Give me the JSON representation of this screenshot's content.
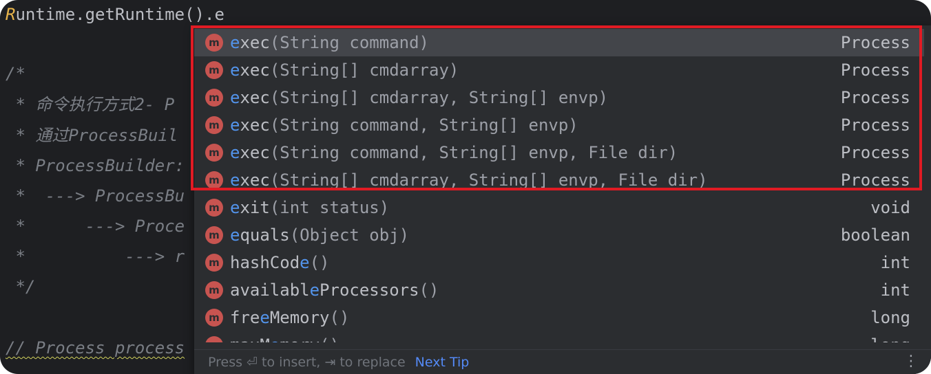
{
  "editor": {
    "top_line_first": "R",
    "top_line_rest": "untime.getRuntime().e",
    "comments": [
      "/*",
      " * 命令执行方式2- P",
      " * 通过ProcessBuil",
      " * ProcessBuilder:",
      " *  ---> ProcessBu",
      " *      ---> Proce",
      " *          ---> r",
      " */",
      "// Process process"
    ]
  },
  "completion": {
    "items": [
      {
        "typed": "e",
        "rest": "xec",
        "params": "(String command)",
        "return_type": "Process",
        "icon": "method-icon",
        "icon_letter": "m"
      },
      {
        "typed": "e",
        "rest": "xec",
        "params": "(String[] cmdarray)",
        "return_type": "Process",
        "icon": "method-icon",
        "icon_letter": "m"
      },
      {
        "typed": "e",
        "rest": "xec",
        "params": "(String[] cmdarray, String[] envp)",
        "return_type": "Process",
        "icon": "method-icon",
        "icon_letter": "m"
      },
      {
        "typed": "e",
        "rest": "xec",
        "params": "(String command, String[] envp)",
        "return_type": "Process",
        "icon": "method-icon",
        "icon_letter": "m"
      },
      {
        "typed": "e",
        "rest": "xec",
        "params": "(String command, String[] envp, File dir)",
        "return_type": "Process",
        "icon": "method-icon",
        "icon_letter": "m"
      },
      {
        "typed": "e",
        "rest": "xec",
        "params": "(String[] cmdarray, String[] envp, File dir)",
        "return_type": "Process",
        "icon": "method-icon",
        "icon_letter": "m"
      },
      {
        "typed": "e",
        "rest": "xit",
        "params": "(int status)",
        "return_type": "void",
        "icon": "method-icon",
        "icon_letter": "m"
      },
      {
        "typed": "e",
        "rest": "quals",
        "params": "(Object obj)",
        "return_type": "boolean",
        "icon": "method-icon",
        "icon_letter": "m"
      },
      {
        "pre": "hashCod",
        "typed": "e",
        "rest": "",
        "params": "()",
        "return_type": "int",
        "icon": "method-icon",
        "icon_letter": "m"
      },
      {
        "pre": "availabl",
        "typed": "e",
        "rest": "Processors",
        "params": "()",
        "return_type": "int",
        "icon": "method-icon",
        "icon_letter": "m"
      },
      {
        "pre": "fre",
        "typed": "e",
        "rest": "Memory",
        "params": "()",
        "return_type": "long",
        "icon": "method-icon",
        "icon_letter": "m"
      },
      {
        "pre": "maxM",
        "typed": "e",
        "rest": "mory",
        "params": "()",
        "return_type": "long",
        "icon": "method-icon",
        "icon_letter": "m"
      }
    ],
    "selected_index": 0,
    "footer_hint": "Press ⏎ to insert, ⇥ to replace",
    "footer_tip": "Next Tip",
    "more_icon": "⋮"
  },
  "annotation": {
    "color": "#e01b24"
  }
}
